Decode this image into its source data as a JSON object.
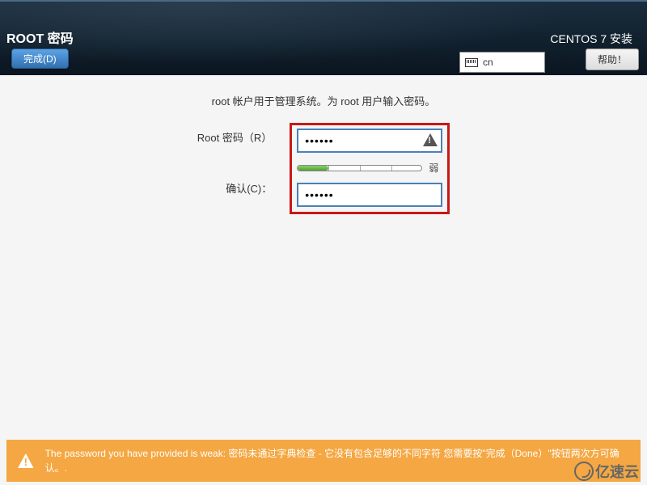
{
  "header": {
    "title": "ROOT 密码",
    "done_label": "完成(D)",
    "install_title": "CENTOS 7 安装",
    "keyboard_layout": "cn",
    "help_label": "帮助！"
  },
  "form": {
    "instruction": "root 帐户用于管理系统。为 root 用户输入密码。",
    "password_label": "Root 密码（R）",
    "confirm_label": "确认(C)：",
    "password_value": "••••••",
    "confirm_value": "••••••",
    "strength_label": "弱"
  },
  "warning": {
    "text": "The password you have provided is weak: 密码未通过字典检查 - 它没有包含足够的不同字符 您需要按\"完成（Done）\"按钮两次方可确认。."
  },
  "watermark": "亿速云"
}
